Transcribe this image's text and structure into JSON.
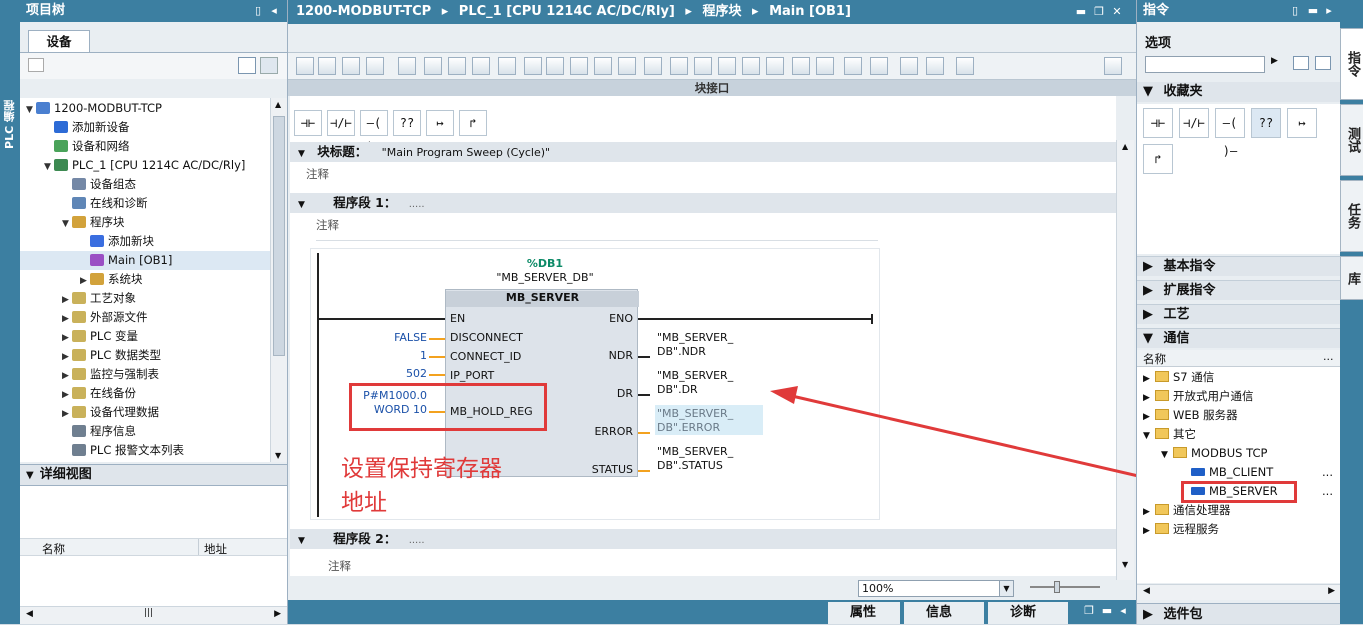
{
  "left_strip": {
    "label": "PLC 编程"
  },
  "project_tree": {
    "title": "项目树",
    "devices_tab": "设备",
    "items": [
      {
        "label": "1200-MODBUT-TCP",
        "level": 0,
        "arrow": "▼",
        "icon_color": "#4a7fd0"
      },
      {
        "label": "添加新设备",
        "level": 1,
        "arrow": "",
        "icon_color": "#2d6bd6"
      },
      {
        "label": "设备和网络",
        "level": 1,
        "arrow": "",
        "icon_color": "#4aa35a"
      },
      {
        "label": "PLC_1 [CPU 1214C AC/DC/Rly]",
        "level": 1,
        "arrow": "▼",
        "icon_color": "#3d8a52"
      },
      {
        "label": "设备组态",
        "level": 2,
        "arrow": "",
        "icon_color": "#7488a6"
      },
      {
        "label": "在线和诊断",
        "level": 2,
        "arrow": "",
        "icon_color": "#5f86b6"
      },
      {
        "label": "程序块",
        "level": 2,
        "arrow": "▼",
        "icon_color": "#d2a23b"
      },
      {
        "label": "添加新块",
        "level": 3,
        "arrow": "",
        "icon_color": "#3a6ee0"
      },
      {
        "label": "Main [OB1]",
        "level": 3,
        "arrow": "",
        "icon_color": "#9b4fc4"
      },
      {
        "label": "系统块",
        "level": 3,
        "arrow": "▶",
        "icon_color": "#d2a23b"
      },
      {
        "label": "工艺对象",
        "level": 2,
        "arrow": "▶",
        "icon_color": "#c9b15a"
      },
      {
        "label": "外部源文件",
        "level": 2,
        "arrow": "▶",
        "icon_color": "#c9b15a"
      },
      {
        "label": "PLC 变量",
        "level": 2,
        "arrow": "▶",
        "icon_color": "#c9b15a"
      },
      {
        "label": "PLC 数据类型",
        "level": 2,
        "arrow": "▶",
        "icon_color": "#c9b15a"
      },
      {
        "label": "监控与强制表",
        "level": 2,
        "arrow": "▶",
        "icon_color": "#c9b15a"
      },
      {
        "label": "在线备份",
        "level": 2,
        "arrow": "▶",
        "icon_color": "#c9b15a"
      },
      {
        "label": "设备代理数据",
        "level": 2,
        "arrow": "▶",
        "icon_color": "#c9b15a"
      },
      {
        "label": "程序信息",
        "level": 2,
        "arrow": "",
        "icon_color": "#6f7f90"
      },
      {
        "label": "PLC 报警文本列表",
        "level": 2,
        "arrow": "",
        "icon_color": "#6f7f90"
      }
    ]
  },
  "detail_view": {
    "title": "详细视图",
    "col_name": "名称",
    "col_address": "地址"
  },
  "editor": {
    "breadcrumb": [
      "1200-MODBUT-TCP",
      "PLC_1 [CPU 1214C AC/DC/Rly]",
      "程序块",
      "Main [OB1]"
    ],
    "interface_bar": "块接口",
    "block_title_label": "块标题：",
    "block_title_value": "\"Main Program Sweep (Cycle)\"",
    "comment": "注释",
    "network1_label": "程序段 1：",
    "network1_dots": ".....",
    "network2_label": "程序段 2：",
    "network2_dots": ".....",
    "zoom": "100%",
    "ladder_buttons": [
      "⊣⊢",
      "⊣/⊢",
      "–( )–",
      "??",
      "↦",
      "↱"
    ]
  },
  "fb": {
    "db_address": "%DB1",
    "db_name": "\"MB_SERVER_DB\"",
    "name": "MB_SERVER",
    "en": "EN",
    "eno": "ENO",
    "inputs": [
      {
        "value": "FALSE",
        "pin": "DISCONNECT"
      },
      {
        "value": "1",
        "pin": "CONNECT_ID"
      },
      {
        "value": "502",
        "pin": "IP_PORT"
      }
    ],
    "hold_reg_value1": "P#M1000.0",
    "hold_reg_value2": "WORD 10",
    "hold_reg_pin": "MB_HOLD_REG",
    "outputs": [
      {
        "pin": "NDR",
        "line1": "\"MB_SERVER_",
        "line2": "DB\".NDR"
      },
      {
        "pin": "DR",
        "line1": "\"MB_SERVER_",
        "line2": "DB\".DR"
      },
      {
        "pin": "ERROR",
        "line1": "\"MB_SERVER_",
        "line2": "DB\".ERROR"
      },
      {
        "pin": "STATUS",
        "line1": "\"MB_SERVER_",
        "line2": "DB\".STATUS"
      }
    ],
    "annotation_line1": "设置保持寄存器",
    "annotation_line2": "地址"
  },
  "bottom_tabs": {
    "properties": "属性",
    "info": "信息",
    "diagnostics": "诊断"
  },
  "instructions": {
    "title": "指令",
    "options": "选项",
    "favorites": "收藏夹",
    "favorite_buttons": [
      "⊣⊢",
      "⊣/⊢",
      "–( )–",
      "??",
      "↦",
      "↱"
    ],
    "basic": "基本指令",
    "extended": "扩展指令",
    "technology": "工艺",
    "communication": "通信",
    "col_name": "名称",
    "col_dots": "...",
    "lib_items": [
      {
        "label": "S7 通信",
        "level": 0,
        "arrow": "▶",
        "type": "folder"
      },
      {
        "label": "开放式用户通信",
        "level": 0,
        "arrow": "▶",
        "type": "folder"
      },
      {
        "label": "WEB 服务器",
        "level": 0,
        "arrow": "▶",
        "type": "folder"
      },
      {
        "label": "其它",
        "level": 0,
        "arrow": "▼",
        "type": "folder"
      },
      {
        "label": "MODBUS TCP",
        "level": 1,
        "arrow": "▼",
        "type": "folder"
      },
      {
        "label": "MB_CLIENT",
        "level": 2,
        "arrow": "",
        "type": "fb"
      },
      {
        "label": "MB_SERVER",
        "level": 2,
        "arrow": "",
        "type": "fb"
      },
      {
        "label": "通信处理器",
        "level": 0,
        "arrow": "▶",
        "type": "folder"
      },
      {
        "label": "远程服务",
        "level": 0,
        "arrow": "▶",
        "type": "folder"
      }
    ],
    "packages": "选件包"
  },
  "side_tabs": [
    "指令",
    "测试",
    "任务",
    "库"
  ],
  "colors": {
    "header": "#3c7fa1",
    "accent": "#e03a3a",
    "selected": "#dce8f3"
  }
}
